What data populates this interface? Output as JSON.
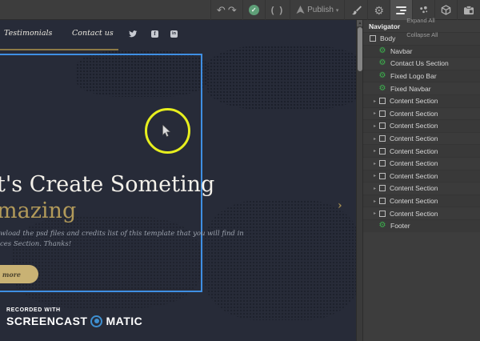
{
  "toolbar": {
    "undo_glyph": "↶",
    "redo_glyph": "↷",
    "check_glyph": "✓",
    "code_glyph": "( )",
    "publish_label": "Publish",
    "publish_chevron": "▾",
    "gear_glyph": "⚙"
  },
  "canvas": {
    "nav_items": [
      "Testimonials",
      "Contact us"
    ],
    "social_icons": [
      "twitter",
      "facebook",
      "linkedin"
    ],
    "facebook_glyph": "f",
    "linkedin_glyph": "in",
    "heading_line1": "t's Create Someting",
    "heading_line2": "mazing",
    "paragraph_line1": "wload the psd files and credits list of this template that you will find in",
    "paragraph_line2": "ces Section. Thanks!",
    "button_label": "rn more",
    "slider_next": "›",
    "watermark": {
      "recorded_with": "RECORDED WITH",
      "brand_left": "SCREENCAST",
      "brand_right": "MATIC"
    },
    "colors": {
      "background": "#272b38",
      "selection_blue": "#3f8fe3",
      "gold": "#b29a5a",
      "cursor_halo_yellow": "#e7ef1e",
      "button_tan": "#c9b274",
      "watermark_blue": "#3e8fd0"
    }
  },
  "scrollbar": {
    "up_arrow": "▲"
  },
  "navigator": {
    "title": "Navigator",
    "expand_all": "Expand All",
    "collapse_all": "Collapse All",
    "rows": [
      {
        "label": "Body",
        "icon": "box",
        "arrow": false,
        "pad": 8
      },
      {
        "label": "Navbar",
        "icon": "symbol",
        "arrow": false,
        "pad": 19
      },
      {
        "label": "Contact Us Section",
        "icon": "symbol",
        "arrow": false,
        "pad": 19
      },
      {
        "label": "Fixed Logo Bar",
        "icon": "symbol",
        "arrow": false,
        "pad": 19
      },
      {
        "label": "Fixed Navbar",
        "icon": "symbol",
        "arrow": false,
        "pad": 19
      },
      {
        "label": "Content Section",
        "icon": "box",
        "arrow": true,
        "pad": 13
      },
      {
        "label": "Content Section",
        "icon": "box",
        "arrow": true,
        "pad": 13
      },
      {
        "label": "Content Section",
        "icon": "box",
        "arrow": true,
        "pad": 13
      },
      {
        "label": "Content Section",
        "icon": "box",
        "arrow": true,
        "pad": 13
      },
      {
        "label": "Content Section",
        "icon": "box",
        "arrow": true,
        "pad": 13
      },
      {
        "label": "Content Section",
        "icon": "box",
        "arrow": true,
        "pad": 13
      },
      {
        "label": "Content Section",
        "icon": "box",
        "arrow": true,
        "pad": 13
      },
      {
        "label": "Content Section",
        "icon": "box",
        "arrow": true,
        "pad": 13
      },
      {
        "label": "Content Section",
        "icon": "box",
        "arrow": true,
        "pad": 13
      },
      {
        "label": "Content Section",
        "icon": "box",
        "arrow": true,
        "pad": 13
      },
      {
        "label": "Footer",
        "icon": "symbol",
        "arrow": false,
        "pad": 19
      }
    ]
  }
}
